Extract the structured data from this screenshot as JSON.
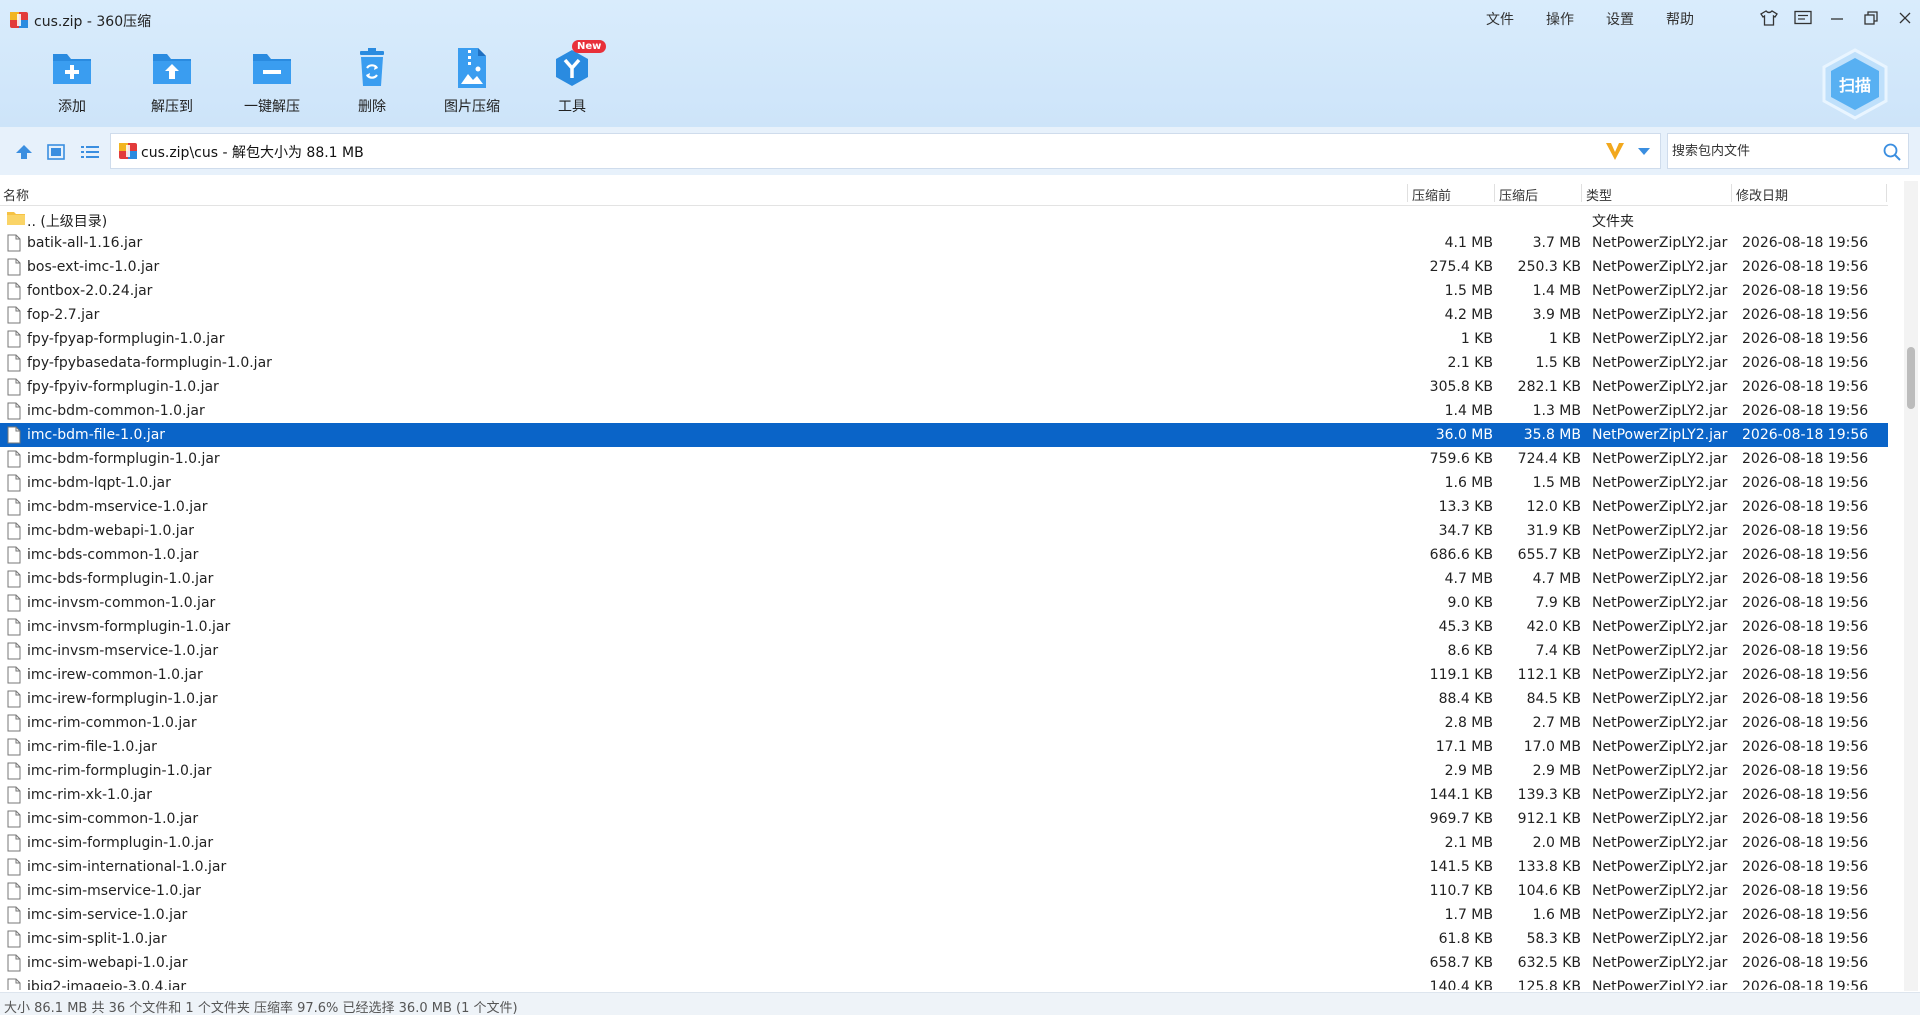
{
  "window": {
    "title": "cus.zip - 360压缩",
    "menu": [
      "文件",
      "操作",
      "设置",
      "帮助"
    ]
  },
  "toolbar": {
    "buttons": [
      {
        "label": "添加",
        "icon": "add-folder-icon"
      },
      {
        "label": "解压到",
        "icon": "extract-to-icon"
      },
      {
        "label": "一键解压",
        "icon": "one-click-extract-icon"
      },
      {
        "label": "删除",
        "icon": "delete-icon"
      },
      {
        "label": "图片压缩",
        "icon": "image-compress-icon"
      },
      {
        "label": "工具",
        "icon": "tools-icon",
        "badge": "New"
      }
    ],
    "scan_label": "扫描"
  },
  "address": {
    "text": "cus.zip\\cus - 解包大小为 88.1 MB",
    "search_placeholder": "搜索包内文件"
  },
  "columns": {
    "name": "名称",
    "original": "压缩前",
    "compressed": "压缩后",
    "type": "类型",
    "modified": "修改日期"
  },
  "rows": [
    {
      "name": ".. (上级目录)",
      "original": "",
      "compressed": "",
      "type": "文件夹",
      "modified": "",
      "folder": true
    },
    {
      "name": "batik-all-1.16.jar",
      "original": "4.1 MB",
      "compressed": "3.7 MB",
      "type": "NetPowerZipLY2.jar",
      "modified": "2026-08-18 19:56"
    },
    {
      "name": "bos-ext-imc-1.0.jar",
      "original": "275.4 KB",
      "compressed": "250.3 KB",
      "type": "NetPowerZipLY2.jar",
      "modified": "2026-08-18 19:56"
    },
    {
      "name": "fontbox-2.0.24.jar",
      "original": "1.5 MB",
      "compressed": "1.4 MB",
      "type": "NetPowerZipLY2.jar",
      "modified": "2026-08-18 19:56"
    },
    {
      "name": "fop-2.7.jar",
      "original": "4.2 MB",
      "compressed": "3.9 MB",
      "type": "NetPowerZipLY2.jar",
      "modified": "2026-08-18 19:56"
    },
    {
      "name": "fpy-fpyap-formplugin-1.0.jar",
      "original": "1 KB",
      "compressed": "1 KB",
      "type": "NetPowerZipLY2.jar",
      "modified": "2026-08-18 19:56"
    },
    {
      "name": "fpy-fpybasedata-formplugin-1.0.jar",
      "original": "2.1 KB",
      "compressed": "1.5 KB",
      "type": "NetPowerZipLY2.jar",
      "modified": "2026-08-18 19:56"
    },
    {
      "name": "fpy-fpyiv-formplugin-1.0.jar",
      "original": "305.8 KB",
      "compressed": "282.1 KB",
      "type": "NetPowerZipLY2.jar",
      "modified": "2026-08-18 19:56"
    },
    {
      "name": "imc-bdm-common-1.0.jar",
      "original": "1.4 MB",
      "compressed": "1.3 MB",
      "type": "NetPowerZipLY2.jar",
      "modified": "2026-08-18 19:56"
    },
    {
      "name": "imc-bdm-file-1.0.jar",
      "original": "36.0 MB",
      "compressed": "35.8 MB",
      "type": "NetPowerZipLY2.jar",
      "modified": "2026-08-18 19:56",
      "selected": true
    },
    {
      "name": "imc-bdm-formplugin-1.0.jar",
      "original": "759.6 KB",
      "compressed": "724.4 KB",
      "type": "NetPowerZipLY2.jar",
      "modified": "2026-08-18 19:56"
    },
    {
      "name": "imc-bdm-lqpt-1.0.jar",
      "original": "1.6 MB",
      "compressed": "1.5 MB",
      "type": "NetPowerZipLY2.jar",
      "modified": "2026-08-18 19:56"
    },
    {
      "name": "imc-bdm-mservice-1.0.jar",
      "original": "13.3 KB",
      "compressed": "12.0 KB",
      "type": "NetPowerZipLY2.jar",
      "modified": "2026-08-18 19:56"
    },
    {
      "name": "imc-bdm-webapi-1.0.jar",
      "original": "34.7 KB",
      "compressed": "31.9 KB",
      "type": "NetPowerZipLY2.jar",
      "modified": "2026-08-18 19:56"
    },
    {
      "name": "imc-bds-common-1.0.jar",
      "original": "686.6 KB",
      "compressed": "655.7 KB",
      "type": "NetPowerZipLY2.jar",
      "modified": "2026-08-18 19:56"
    },
    {
      "name": "imc-bds-formplugin-1.0.jar",
      "original": "4.7 MB",
      "compressed": "4.7 MB",
      "type": "NetPowerZipLY2.jar",
      "modified": "2026-08-18 19:56"
    },
    {
      "name": "imc-invsm-common-1.0.jar",
      "original": "9.0 KB",
      "compressed": "7.9 KB",
      "type": "NetPowerZipLY2.jar",
      "modified": "2026-08-18 19:56"
    },
    {
      "name": "imc-invsm-formplugin-1.0.jar",
      "original": "45.3 KB",
      "compressed": "42.0 KB",
      "type": "NetPowerZipLY2.jar",
      "modified": "2026-08-18 19:56"
    },
    {
      "name": "imc-invsm-mservice-1.0.jar",
      "original": "8.6 KB",
      "compressed": "7.4 KB",
      "type": "NetPowerZipLY2.jar",
      "modified": "2026-08-18 19:56"
    },
    {
      "name": "imc-irew-common-1.0.jar",
      "original": "119.1 KB",
      "compressed": "112.1 KB",
      "type": "NetPowerZipLY2.jar",
      "modified": "2026-08-18 19:56"
    },
    {
      "name": "imc-irew-formplugin-1.0.jar",
      "original": "88.4 KB",
      "compressed": "84.5 KB",
      "type": "NetPowerZipLY2.jar",
      "modified": "2026-08-18 19:56"
    },
    {
      "name": "imc-rim-common-1.0.jar",
      "original": "2.8 MB",
      "compressed": "2.7 MB",
      "type": "NetPowerZipLY2.jar",
      "modified": "2026-08-18 19:56"
    },
    {
      "name": "imc-rim-file-1.0.jar",
      "original": "17.1 MB",
      "compressed": "17.0 MB",
      "type": "NetPowerZipLY2.jar",
      "modified": "2026-08-18 19:56"
    },
    {
      "name": "imc-rim-formplugin-1.0.jar",
      "original": "2.9 MB",
      "compressed": "2.9 MB",
      "type": "NetPowerZipLY2.jar",
      "modified": "2026-08-18 19:56"
    },
    {
      "name": "imc-rim-xk-1.0.jar",
      "original": "144.1 KB",
      "compressed": "139.3 KB",
      "type": "NetPowerZipLY2.jar",
      "modified": "2026-08-18 19:56"
    },
    {
      "name": "imc-sim-common-1.0.jar",
      "original": "969.7 KB",
      "compressed": "912.1 KB",
      "type": "NetPowerZipLY2.jar",
      "modified": "2026-08-18 19:56"
    },
    {
      "name": "imc-sim-formplugin-1.0.jar",
      "original": "2.1 MB",
      "compressed": "2.0 MB",
      "type": "NetPowerZipLY2.jar",
      "modified": "2026-08-18 19:56"
    },
    {
      "name": "imc-sim-international-1.0.jar",
      "original": "141.5 KB",
      "compressed": "133.8 KB",
      "type": "NetPowerZipLY2.jar",
      "modified": "2026-08-18 19:56"
    },
    {
      "name": "imc-sim-mservice-1.0.jar",
      "original": "110.7 KB",
      "compressed": "104.6 KB",
      "type": "NetPowerZipLY2.jar",
      "modified": "2026-08-18 19:56"
    },
    {
      "name": "imc-sim-service-1.0.jar",
      "original": "1.7 MB",
      "compressed": "1.6 MB",
      "type": "NetPowerZipLY2.jar",
      "modified": "2026-08-18 19:56"
    },
    {
      "name": "imc-sim-split-1.0.jar",
      "original": "61.8 KB",
      "compressed": "58.3 KB",
      "type": "NetPowerZipLY2.jar",
      "modified": "2026-08-18 19:56"
    },
    {
      "name": "imc-sim-webapi-1.0.jar",
      "original": "658.7 KB",
      "compressed": "632.5 KB",
      "type": "NetPowerZipLY2.jar",
      "modified": "2026-08-18 19:56"
    },
    {
      "name": "jbig2-imageio-3.0.4.jar",
      "original": "140.4 KB",
      "compressed": "125.8 KB",
      "type": "NetPowerZipLY2.jar",
      "modified": "2026-08-18 19:56"
    }
  ],
  "status": {
    "text": "大小 86.1 MB 共 36 个文件和 1 个文件夹 压缩率 97.6% 已经选择 36.0 MB (1 个文件)"
  },
  "colors": {
    "accent": "#2a8be0",
    "selection": "#0a64c8",
    "header_bg": "#d9ecfc"
  }
}
